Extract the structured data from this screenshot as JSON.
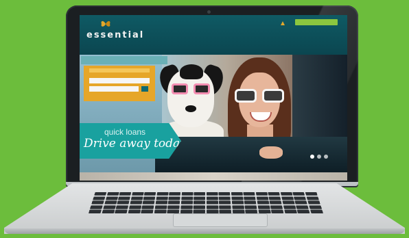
{
  "site": {
    "brand": "essential",
    "tagline": "",
    "login_button": "",
    "utility_text": "",
    "nav": [
      "",
      "",
      "",
      "",
      "",
      ""
    ],
    "tab_label": "",
    "promo_small": "quick loans",
    "promo_big": "Drive away today"
  },
  "colors": {
    "background": "#6cbd3c",
    "header": "#0f5a64",
    "accent_orange": "#e6a629",
    "accent_teal": "#19a19f",
    "accent_green": "#8cc63f"
  },
  "icons": {
    "logo": "butterfly-logo-icon",
    "user": "person-icon"
  },
  "slider": {
    "dot_count": 3,
    "active": 1
  }
}
